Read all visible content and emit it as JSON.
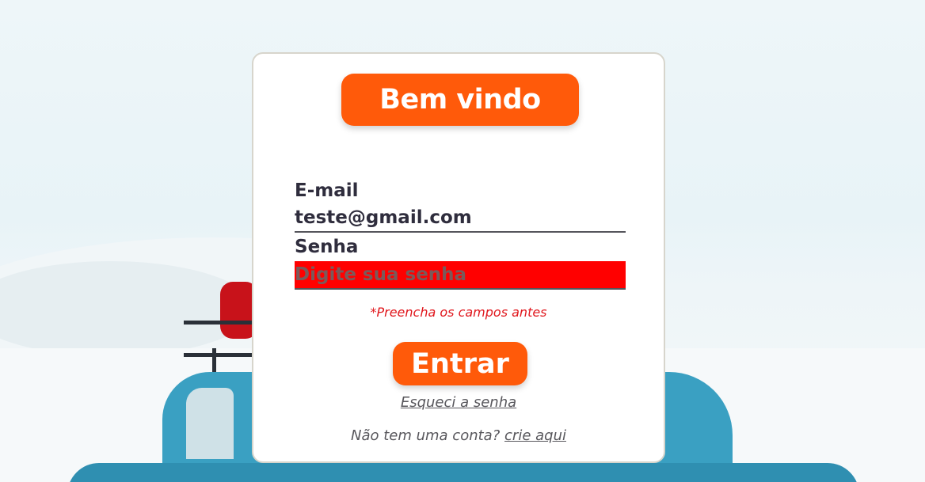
{
  "login": {
    "title": "Bem vindo",
    "email_label": "E-mail",
    "email_value": "teste@gmail.com",
    "password_label": "Senha",
    "password_placeholder": "Digite sua senha",
    "error_message": "*Preencha os campos antes",
    "submit_label": "Entrar",
    "forgot_link": "Esqueci a senha",
    "signup_text": "Não tem uma conta?",
    "signup_link": "crie aqui"
  },
  "colors": {
    "accent": "#ff5a0a",
    "error_field": "#ff0000",
    "error_text": "#e0161c",
    "text_dark": "#2f2d3d"
  }
}
